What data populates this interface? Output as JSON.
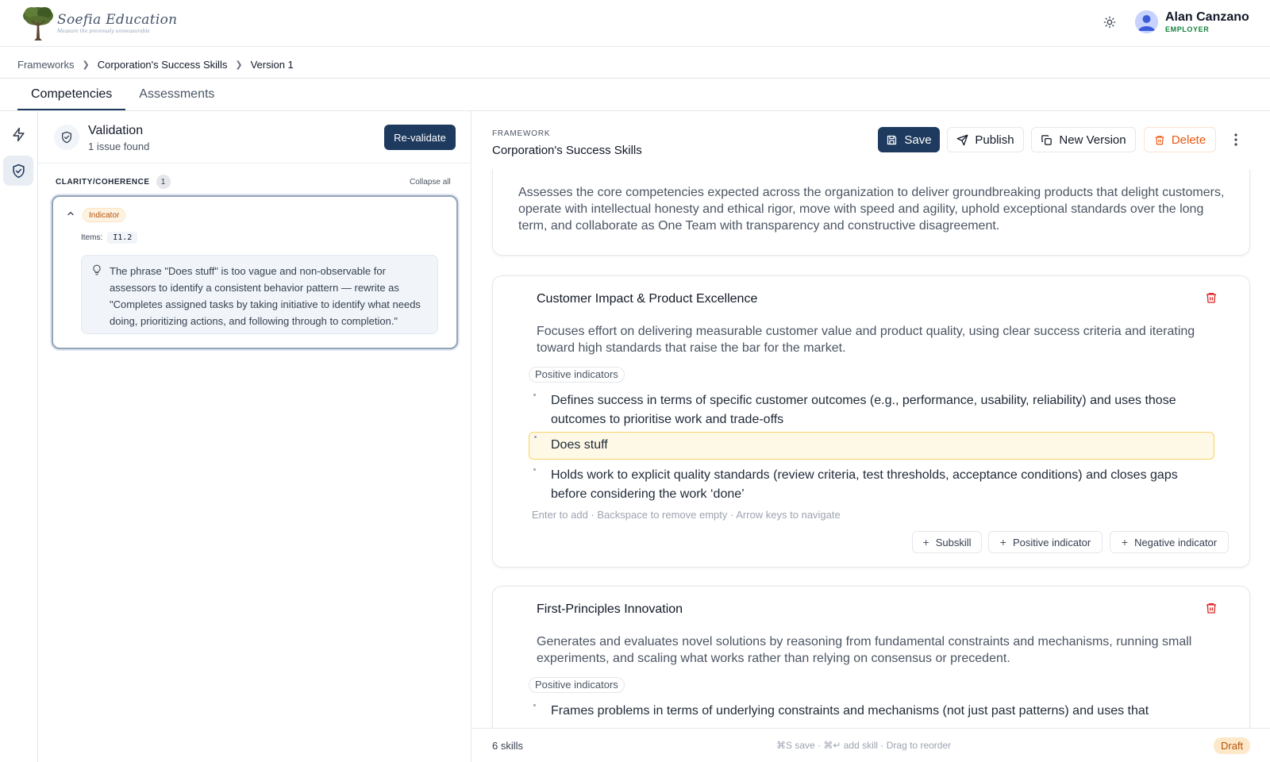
{
  "brand": {
    "name": "Soefia Education",
    "tagline": "Measure the previously unmeasurable"
  },
  "user": {
    "name": "Alan Canzano",
    "role": "EMPLOYER"
  },
  "breadcrumb": {
    "items": [
      "Frameworks",
      "Corporation's Success Skills",
      "Version 1"
    ]
  },
  "tabs": [
    {
      "label": "Competencies",
      "active": true
    },
    {
      "label": "Assessments",
      "active": false
    }
  ],
  "validation": {
    "title": "Validation",
    "subtitle": "1 issue found",
    "revalidate_label": "Re-validate",
    "category": "CLARITY/COHERENCE",
    "category_count": "1",
    "collapse_label": "Collapse all",
    "issue": {
      "badge": "Indicator",
      "items_label": "Items:",
      "item_code": "I1.2",
      "hint": "The phrase \"Does stuff\" is too vague and non-observable for assessors to identify a consistent behavior pattern — rewrite as \"Completes assigned tasks by taking initiative to identify what needs doing, prioritizing actions, and following through to completion.\""
    }
  },
  "framework": {
    "label": "FRAMEWORK",
    "name": "Corporation's Success Skills",
    "actions": {
      "save": "Save",
      "publish": "Publish",
      "new_version": "New Version",
      "delete": "Delete"
    },
    "description": "Assesses the core competencies expected across the organization to deliver groundbreaking products that delight customers, operate with intellectual honesty and ethical rigor, move with speed and agility, uphold exceptional standards over the long term, and collaborate as One Team with transparency and constructive disagreement."
  },
  "skills": [
    {
      "title": "Customer Impact & Product Excellence",
      "description": "Focuses effort on delivering measurable customer value and product quality, using clear success criteria and iterating toward high standards that raise the bar for the market.",
      "indicators_label": "Positive indicators",
      "indicators": [
        "Defines success in terms of specific customer outcomes (e.g., performance, usability, reliability) and uses those outcomes to prioritise work and trade-offs",
        "Does stuff",
        "Holds work to explicit quality standards (review criteria, test thresholds, acceptance conditions) and closes gaps before considering the work ‘done’"
      ],
      "keyboard_hint": "Enter to add · Backspace to remove empty · Arrow keys to navigate",
      "add_buttons": [
        "Subskill",
        "Positive indicator",
        "Negative indicator"
      ]
    },
    {
      "title": "First-Principles Innovation",
      "description": "Generates and evaluates novel solutions by reasoning from fundamental constraints and mechanisms, running small experiments, and scaling what works rather than relying on consensus or precedent.",
      "indicators_label": "Positive indicators",
      "indicators": [
        "Frames problems in terms of underlying constraints and mechanisms (not just past patterns) and uses that"
      ]
    }
  ],
  "footer": {
    "skills_count": "6 skills",
    "shortcuts": "⌘S save · ⌘↵ add skill · Drag to reorder",
    "status": "Draft"
  },
  "colors": {
    "primary": "#1e3a5f",
    "danger": "#dc2626",
    "warning_bg": "#fef9e7",
    "draft_bg": "#fde8c9"
  },
  "icons": [
    "tree-logo-icon",
    "sun-icon",
    "chevron-right-icon",
    "lightning-icon",
    "shield-check-icon",
    "chevron-up-icon",
    "lightbulb-icon",
    "save-icon",
    "send-icon",
    "copy-icon",
    "trash-icon",
    "more-vertical-icon",
    "plus-icon"
  ]
}
